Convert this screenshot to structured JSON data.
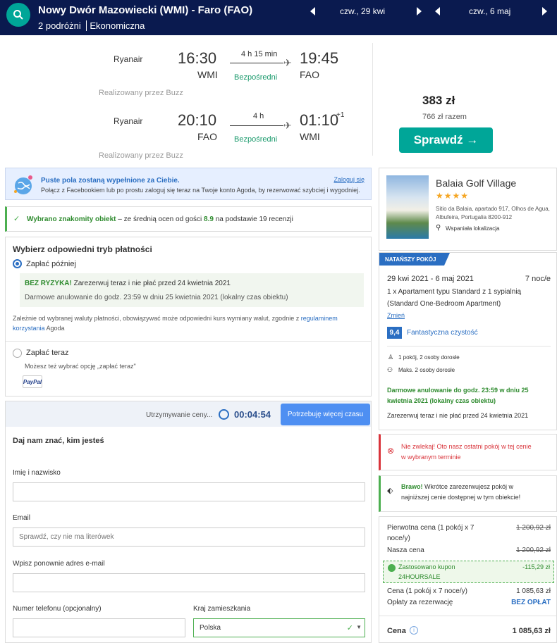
{
  "header": {
    "route": "Nowy Dwór Mazowiecki (WMI) - Faro (FAO)",
    "travelers": "2 podróżni",
    "cabin": "Ekonomiczna",
    "depart_date": "czw., 29 kwi",
    "return_date": "czw., 6 maj"
  },
  "flights": [
    {
      "airline": "Ryanair",
      "dep_time": "16:30",
      "dep_code": "WMI",
      "duration": "4 h 15 min",
      "stops": "Bezpośredni",
      "arr_time": "19:45",
      "arr_code": "FAO",
      "arr_plus": "",
      "operated_by": "Realizowany przez Buzz"
    },
    {
      "airline": "Ryanair",
      "dep_time": "20:10",
      "dep_code": "FAO",
      "duration": "4 h",
      "stops": "Bezpośredni",
      "arr_time": "01:10",
      "arr_code": "WMI",
      "arr_plus": "+1",
      "operated_by": "Realizowany przez Buzz"
    }
  ],
  "price": {
    "per": "383 zł",
    "total": "766 zł razem",
    "check_label": "Sprawdź →"
  },
  "fb": {
    "title": "Puste pola zostaną wypełnione za Ciebie.",
    "text": "Połącz z Facebookiem lub po prostu zaloguj się teraz na Twoje konto Agoda, by rezerwować szybciej i wygodniej.",
    "login": "Zaloguj się"
  },
  "known": {
    "check": "✓",
    "bold": "Wybrano znakomity obiekt",
    "text1": " – ze średnią ocen od gości ",
    "score": "8.9",
    "text2": " na podstawie 19 recenzji"
  },
  "payment": {
    "title": "Wybierz odpowiedni tryb płatności",
    "later": "Zapłać później",
    "risk_title": "BEZ RYZYKA!",
    "risk_text": " Zarezerwuj teraz i nie płać przed 24 kwietnia 2021",
    "cancel_text": "Darmowe anulowanie do godz. 23:59 w dniu 25 kwietnia 2021 (lokalny czas obiektu)",
    "fx_text1": "Zależnie od wybranej waluty płatności, obowiązywać może odpowiedni kurs wymiany walut, zgodnie z ",
    "fx_link": "regulaminem korzystania",
    "fx_text2": " Agoda",
    "now": "Zapłać teraz",
    "now_text": "Możesz też wybrać opcję „zapłać teraz\"",
    "paypal": "PayPal"
  },
  "form": {
    "timer_label": "Utrzymywanie ceny...",
    "timer": "00:04:54",
    "more_time": "Potrzebuję więcej czasu",
    "title": "Daj nam znać, kim jesteś",
    "name_label": "Imię i nazwisko",
    "email_label": "Email",
    "email_placeholder": "Sprawdź, czy nie ma literówek",
    "email2_label": "Wpisz ponownie adres e-mail",
    "phone_label": "Numer telefonu (opcjonalny)",
    "country_label": "Kraj zamieszkania",
    "country_value": "Polska"
  },
  "hotel": {
    "name": "Balaia Golf Village",
    "stars": "★★★★",
    "address": "Sitio da Balaia, apartado 917, Olhos de Agua, Albufeira, Portugalia 8200-912",
    "location": "Wspaniała lokalizacja"
  },
  "room": {
    "badge": "NATAŃSZY POKÓJ",
    "dates": "29 kwi 2021 - 6 maj 2021",
    "nights": "7 noc/e",
    "type_line1": "1 x Apartament typu Standard z 1 sypialnią",
    "type_line2": "(Standard One-Bedroom Apartment)",
    "change": "Zmień",
    "score": "9,4",
    "score_label": "Fantastyczna czystość",
    "rooms": "1 pokój, 2 osoby dorosłe",
    "max": "Maks. 2 osoby dorosłe",
    "free_cancel_1": "Darmowe anulowanie do godz. 23:59 w dniu 25",
    "free_cancel_2": "kwietnia 2021 (lokalny czas obiektu)",
    "book_now": "Zarezerwuj teraz i nie płać przed 24 kwietnia 2021"
  },
  "urgent": {
    "line1": "Nie zwlekaj! Oto nasz ostatni pokój w tej cenie",
    "line2": "w wybranym terminie"
  },
  "brawo": {
    "bold": "Brawo!",
    "line1": " Wkrótce zarezerwujesz pokój w",
    "line2": "najniższej cenie dostępnej w tym obiekcie!"
  },
  "summary": {
    "orig_label_1": "Pierwotna cena (1 pokój x 7",
    "orig_label_2": "noce/y)",
    "orig_value": "1 200,92 zł",
    "our_label": "Nasza cena",
    "our_value": "1 200,92 zł",
    "coupon_label_1": "Zastosowano kupon",
    "coupon_label_2": "24HOURSALE",
    "coupon_value": "-115,29 zł",
    "price_label": "Cena (1 pokój x 7 noce/y)",
    "price_value": "1 085,63 zł",
    "fees_label": "Opłaty za rezerwację",
    "fees_value": "BEZ OPŁAT",
    "total_label": "Cena",
    "total_value": "1 085,63 zł"
  },
  "colors": {
    "header_bg": "#0a1a4f",
    "accent_teal": "#00a698",
    "link_blue": "#2a6ec2",
    "success_green": "#2e8b2e",
    "urgent_red": "#d9333a"
  }
}
